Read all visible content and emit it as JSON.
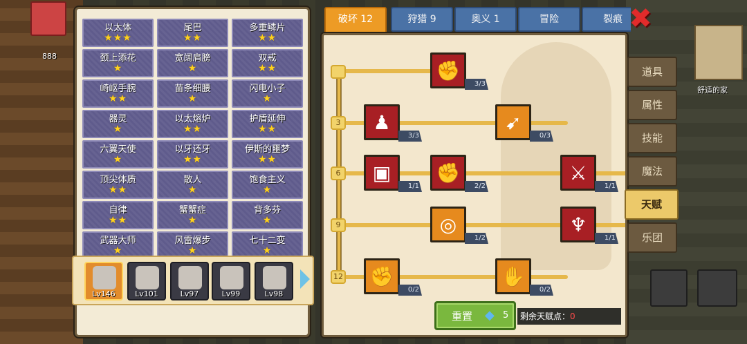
{
  "skills": [
    {
      "name": "以太体",
      "stars": 3
    },
    {
      "name": "尾巴",
      "stars": 2
    },
    {
      "name": "多重鳞片",
      "stars": 2
    },
    {
      "name": "颈上添花",
      "stars": 1
    },
    {
      "name": "宽阔肩膀",
      "stars": 1
    },
    {
      "name": "双戒",
      "stars": 2
    },
    {
      "name": "崎岖手腕",
      "stars": 2
    },
    {
      "name": "苗条细腰",
      "stars": 1
    },
    {
      "name": "闪电小子",
      "stars": 1
    },
    {
      "name": "器灵",
      "stars": 1
    },
    {
      "name": "以太熔炉",
      "stars": 2
    },
    {
      "name": "护盾延伸",
      "stars": 2
    },
    {
      "name": "六翼天使",
      "stars": 1
    },
    {
      "name": "以牙还牙",
      "stars": 2
    },
    {
      "name": "伊斯的噩梦",
      "stars": 2
    },
    {
      "name": "顶尖体质",
      "stars": 2
    },
    {
      "name": "散人",
      "stars": 1
    },
    {
      "name": "饱食主义",
      "stars": 1
    },
    {
      "name": "自律",
      "stars": 2
    },
    {
      "name": "蟹蟹症",
      "stars": 1
    },
    {
      "name": "背多芬",
      "stars": 1
    },
    {
      "name": "武器大师",
      "stars": 1
    },
    {
      "name": "风雷爆步",
      "stars": 1
    },
    {
      "name": "七十二变",
      "stars": 1
    }
  ],
  "characters": [
    {
      "level": "Lv146",
      "selected": true
    },
    {
      "level": "Lv101",
      "selected": false
    },
    {
      "level": "Lv97",
      "selected": false
    },
    {
      "level": "Lv99",
      "selected": false
    },
    {
      "level": "Lv98",
      "selected": false
    }
  ],
  "tabs": [
    {
      "label": "破坏 12",
      "active": true
    },
    {
      "label": "狩猎 9",
      "active": false
    },
    {
      "label": "奥义 1",
      "active": false
    },
    {
      "label": "冒险",
      "active": false
    },
    {
      "label": "裂痕",
      "active": false
    }
  ],
  "tiers": [
    "3",
    "6",
    "9",
    "12"
  ],
  "talents": [
    {
      "icon": "arm-wrestle-icon",
      "count": "3/3",
      "color": "red"
    },
    {
      "icon": "muscle-body-icon",
      "count": "3/3",
      "color": "red"
    },
    {
      "icon": "arrow-hit-icon",
      "count": "0/3",
      "color": "orange"
    },
    {
      "icon": "cards-icon",
      "count": "1/1",
      "color": "red"
    },
    {
      "icon": "fist-punch-icon",
      "count": "2/2",
      "color": "red"
    },
    {
      "icon": "blade-strike-icon",
      "count": "1/1",
      "color": "red"
    },
    {
      "icon": "ring-target-icon",
      "count": "1/2",
      "color": "orange"
    },
    {
      "icon": "bat-wings-icon",
      "count": "1/1",
      "color": "red"
    },
    {
      "icon": "raised-fist-icon",
      "count": "0/2",
      "color": "orange"
    },
    {
      "icon": "grab-hand-icon",
      "count": "0/2",
      "color": "orange"
    }
  ],
  "reset": {
    "label": "重置",
    "cost": "5"
  },
  "remaining": {
    "label": "剩余天赋点：",
    "value": "0"
  },
  "sidemenu": [
    {
      "label": "道具",
      "active": false
    },
    {
      "label": "属性",
      "active": false
    },
    {
      "label": "技能",
      "active": false
    },
    {
      "label": "魔法",
      "active": false
    },
    {
      "label": "天赋",
      "active": true
    },
    {
      "label": "乐团",
      "active": false
    }
  ],
  "location": "舒适的家",
  "hud_count": "888",
  "close_symbol": "✖"
}
